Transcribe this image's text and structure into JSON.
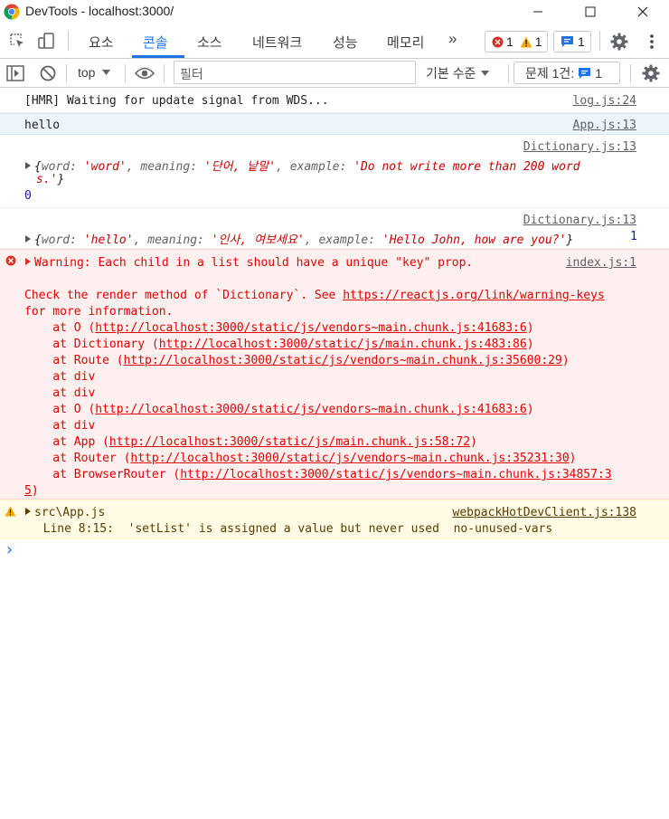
{
  "window": {
    "title": "DevTools - localhost:3000/"
  },
  "tabs": [
    {
      "label": "요소"
    },
    {
      "label": "콘솔"
    },
    {
      "label": "소스"
    },
    {
      "label": "네트워크"
    },
    {
      "label": "성능"
    },
    {
      "label": "메모리"
    }
  ],
  "more_tabs": "»",
  "counts": {
    "errors": "1",
    "warnings": "1",
    "messages": "1"
  },
  "filterbar": {
    "context": "top",
    "filter_placeholder": "필터",
    "level": "기본 수준",
    "issues_label": "문제 1건:",
    "issues_count": "1"
  },
  "console": {
    "hmr": {
      "text": "[HMR] Waiting for update signal from WDS...",
      "source": "log.js:24"
    },
    "hello": {
      "text": "hello",
      "source": "App.js:13"
    },
    "dict1": {
      "source": "Dictionary.js:13",
      "open": "{",
      "k1": "word",
      "v1": "'word'",
      "k2": "meaning",
      "v2": "'단어, 낱말'",
      "k3": "example",
      "v3a": "'Do not write more than 200 word",
      "v3b": "s.'",
      "close": "}",
      "trail": "0"
    },
    "dict2": {
      "source": "Dictionary.js:13",
      "open": "{",
      "k1": "word",
      "v1": "'hello'",
      "k2": "meaning",
      "v2": "'인사, 여보세요'",
      "k3": "example",
      "v3": "'Hello John, how are you?'",
      "close": "}",
      "trail": "1"
    },
    "error": {
      "source": "index.js:1",
      "warning": "Warning: Each child in a list should have a unique \"key\" prop.",
      "check_prefix": "Check the render method of `Dictionary`. See ",
      "check_link": "https://reactjs.org/link/warning-keys",
      "check_suffix": "for more information.",
      "stack": [
        {
          "pre": "    at O (",
          "url": "http://localhost:3000/static/js/vendors~main.chunk.js:41683:6",
          "post": ")"
        },
        {
          "pre": "    at Dictionary (",
          "url": "http://localhost:3000/static/js/main.chunk.js:483:86",
          "post": ")"
        },
        {
          "pre": "    at Route (",
          "url": "http://localhost:3000/static/js/vendors~main.chunk.js:35600:29",
          "post": ")"
        },
        {
          "pre": "    at div",
          "url": "",
          "post": ""
        },
        {
          "pre": "    at div",
          "url": "",
          "post": ""
        },
        {
          "pre": "    at O (",
          "url": "http://localhost:3000/static/js/vendors~main.chunk.js:41683:6",
          "post": ")"
        },
        {
          "pre": "    at div",
          "url": "",
          "post": ""
        },
        {
          "pre": "    at App (",
          "url": "http://localhost:3000/static/js/main.chunk.js:58:72",
          "post": ")"
        },
        {
          "pre": "    at Router (",
          "url": "http://localhost:3000/static/js/vendors~main.chunk.js:35231:30",
          "post": ")"
        },
        {
          "pre": "    at BrowserRouter (",
          "url": "http://localhost:3000/static/js/vendors~main.chunk.js:34857:3",
          "post": ""
        }
      ],
      "stack_tail_url": "5",
      "stack_tail_post": ")"
    },
    "warn": {
      "file": "src\\App.js",
      "source": "webpackHotDevClient.js:138",
      "detail": "  Line 8:15:  'setList' is assigned a value but never used  no-unused-vars"
    },
    "prompt": "›"
  }
}
